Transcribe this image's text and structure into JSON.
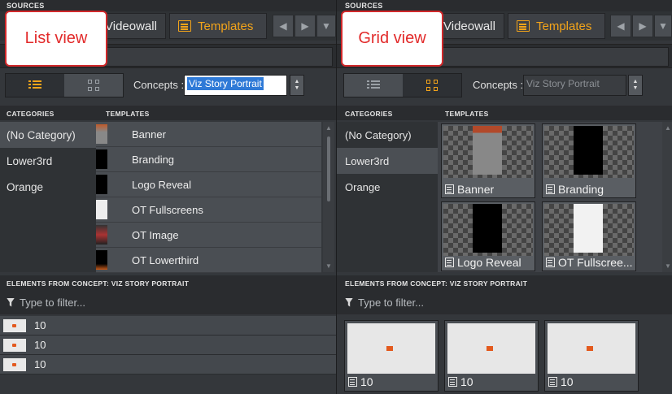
{
  "left": {
    "callout": "List view",
    "sources_label": "SOURCES",
    "tabs": {
      "videowall": "Videowall",
      "templates": "Templates"
    },
    "concepts_label": "Concepts :",
    "concept_value": "Viz Story Portrait",
    "categories_header": "CATEGORIES",
    "templates_header": "TEMPLATES",
    "categories": [
      "(No Category)",
      "Lower3rd",
      "Orange"
    ],
    "templates": [
      "Banner",
      "Branding",
      "Logo Reveal",
      "OT Fullscreens",
      "OT Image",
      "OT Lowerthird"
    ],
    "elements_header": "ELEMENTS FROM CONCEPT: VIZ STORY PORTRAIT",
    "filter_placeholder": "Type to filter...",
    "elements": [
      "10",
      "10",
      "10"
    ]
  },
  "right": {
    "callout": "Grid view",
    "sources_label": "SOURCES",
    "tabs": {
      "videowall": "Videowall",
      "templates": "Templates"
    },
    "concepts_label": "Concepts :",
    "concept_value": "Viz Story Portrait",
    "categories_header": "CATEGORIES",
    "templates_header": "TEMPLATES",
    "categories": [
      "(No Category)",
      "Lower3rd",
      "Orange"
    ],
    "templates": [
      "Banner",
      "Branding",
      "Logo Reveal",
      "OT Fullscree..."
    ],
    "elements_header": "ELEMENTS FROM CONCEPT: VIZ STORY PORTRAIT",
    "filter_placeholder": "Type to filter...",
    "elements": [
      "10",
      "10",
      "10"
    ]
  },
  "colors": {
    "accent": "#f3a41a",
    "callout_border": "#d1282a",
    "selection": "#2f7ad7"
  }
}
